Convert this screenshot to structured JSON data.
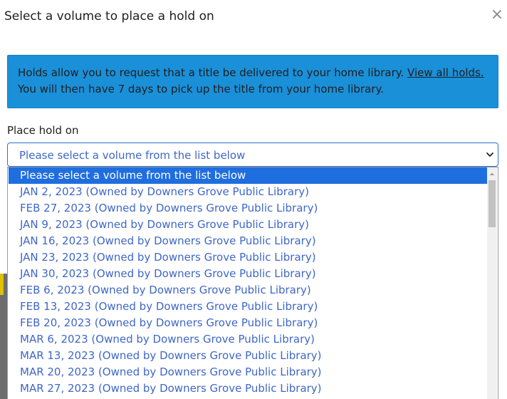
{
  "modal": {
    "title": "Select a volume to place a hold on",
    "close_icon": "close-icon",
    "close_glyph": "×"
  },
  "info": {
    "text_before": "Holds allow you to request that a title be delivered to your home library. ",
    "link_text": "View all holds.",
    "text_after": " You will then have 7 days to pick up the title from your home library.",
    "background_color": "#1a90d9"
  },
  "field": {
    "label": "Place hold on",
    "selected_value": "Please select a volume from the list below",
    "chevron_icon": "chevron-down-icon"
  },
  "dropdown": {
    "selected_index": 0,
    "options": [
      "Please select a volume from the list below",
      "JAN 2, 2023 (Owned by Downers Grove Public Library)",
      "FEB 27, 2023 (Owned by Downers Grove Public Library)",
      "JAN 9, 2023 (Owned by Downers Grove Public Library)",
      "JAN 16, 2023 (Owned by Downers Grove Public Library)",
      "JAN 23, 2023 (Owned by Downers Grove Public Library)",
      "JAN 30, 2023 (Owned by Downers Grove Public Library)",
      "FEB 6, 2023 (Owned by Downers Grove Public Library)",
      "FEB 13, 2023 (Owned by Downers Grove Public Library)",
      "FEB 20, 2023 (Owned by Downers Grove Public Library)",
      "MAR 6, 2023 (Owned by Downers Grove Public Library)",
      "MAR 13, 2023 (Owned by Downers Grove Public Library)",
      "MAR 20, 2023 (Owned by Downers Grove Public Library)",
      "MAR 27, 2023 (Owned by Downers Grove Public Library)"
    ],
    "option_color": "#3f67c8",
    "highlight_color": "#1f6ee0"
  }
}
